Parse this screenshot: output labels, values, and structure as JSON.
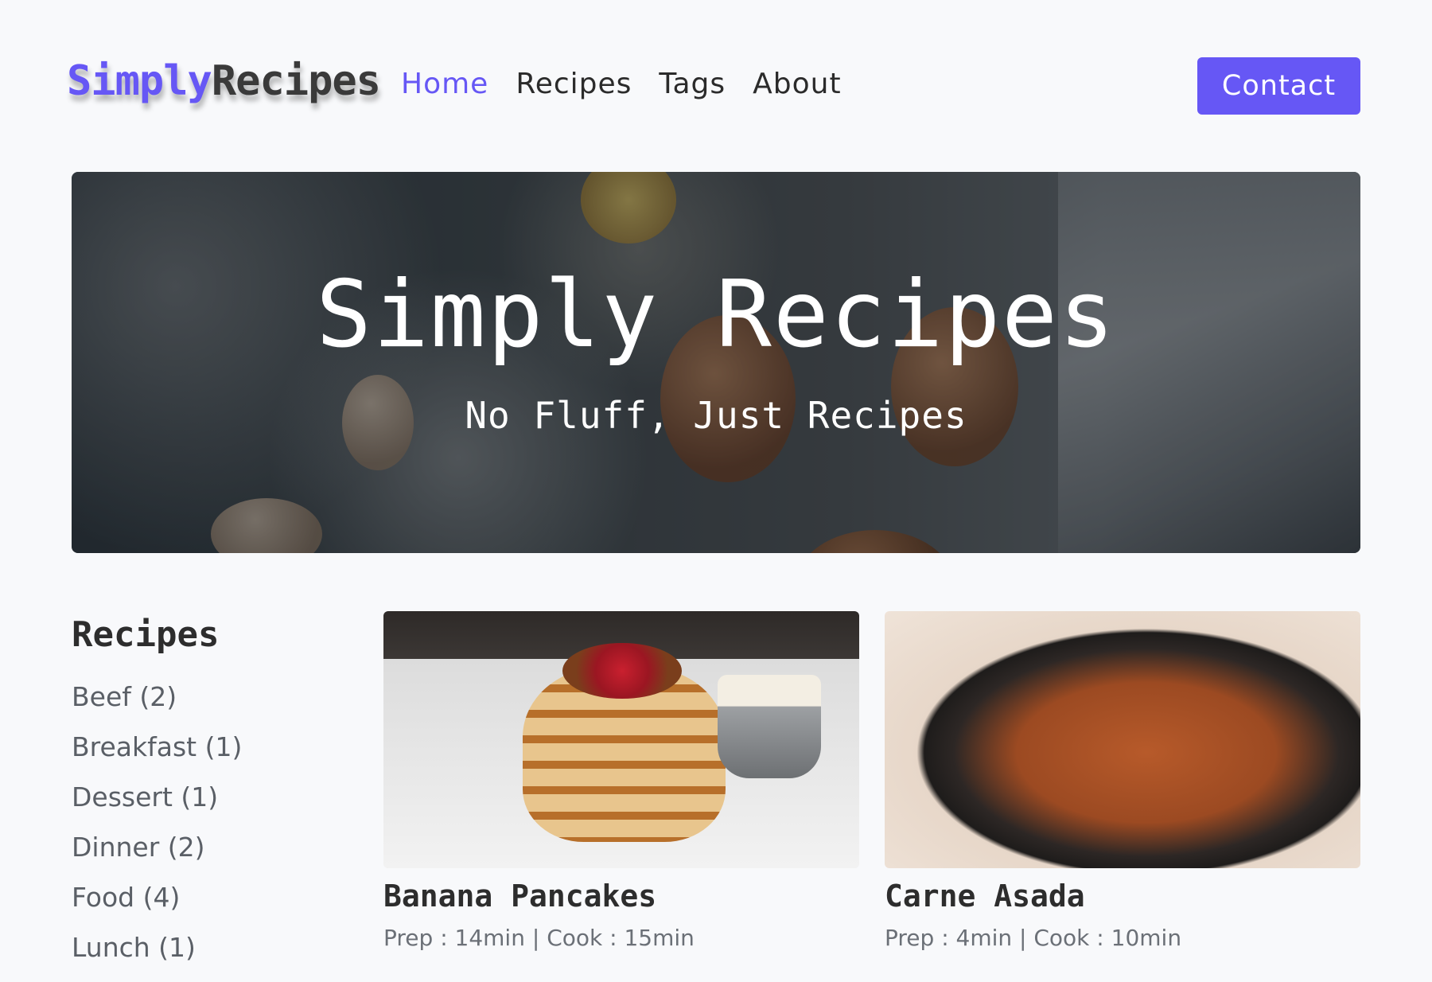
{
  "nav": {
    "logo_part1": "Simply",
    "logo_part2": "Recipes",
    "links": [
      {
        "label": "Home",
        "active": true
      },
      {
        "label": "Recipes",
        "active": false
      },
      {
        "label": "Tags",
        "active": false
      },
      {
        "label": "About",
        "active": false
      }
    ],
    "contact_label": "Contact"
  },
  "hero": {
    "title": "Simply Recipes",
    "subtitle": "No Fluff, Just Recipes"
  },
  "sidebar": {
    "title": "Recipes",
    "items": [
      {
        "label": "Beef (2)"
      },
      {
        "label": "Breakfast (1)"
      },
      {
        "label": "Dessert (1)"
      },
      {
        "label": "Dinner (2)"
      },
      {
        "label": "Food (4)"
      },
      {
        "label": "Lunch (1)"
      }
    ]
  },
  "recipes": [
    {
      "title": "Banana Pancakes",
      "meta": "Prep : 14min | Cook : 15min"
    },
    {
      "title": "Carne Asada",
      "meta": "Prep : 4min | Cook : 10min"
    }
  ],
  "colors": {
    "accent": "#6657f5",
    "text_dark": "#2d2d2d",
    "text_muted": "#5a5f66",
    "background": "#f8f9fb"
  }
}
